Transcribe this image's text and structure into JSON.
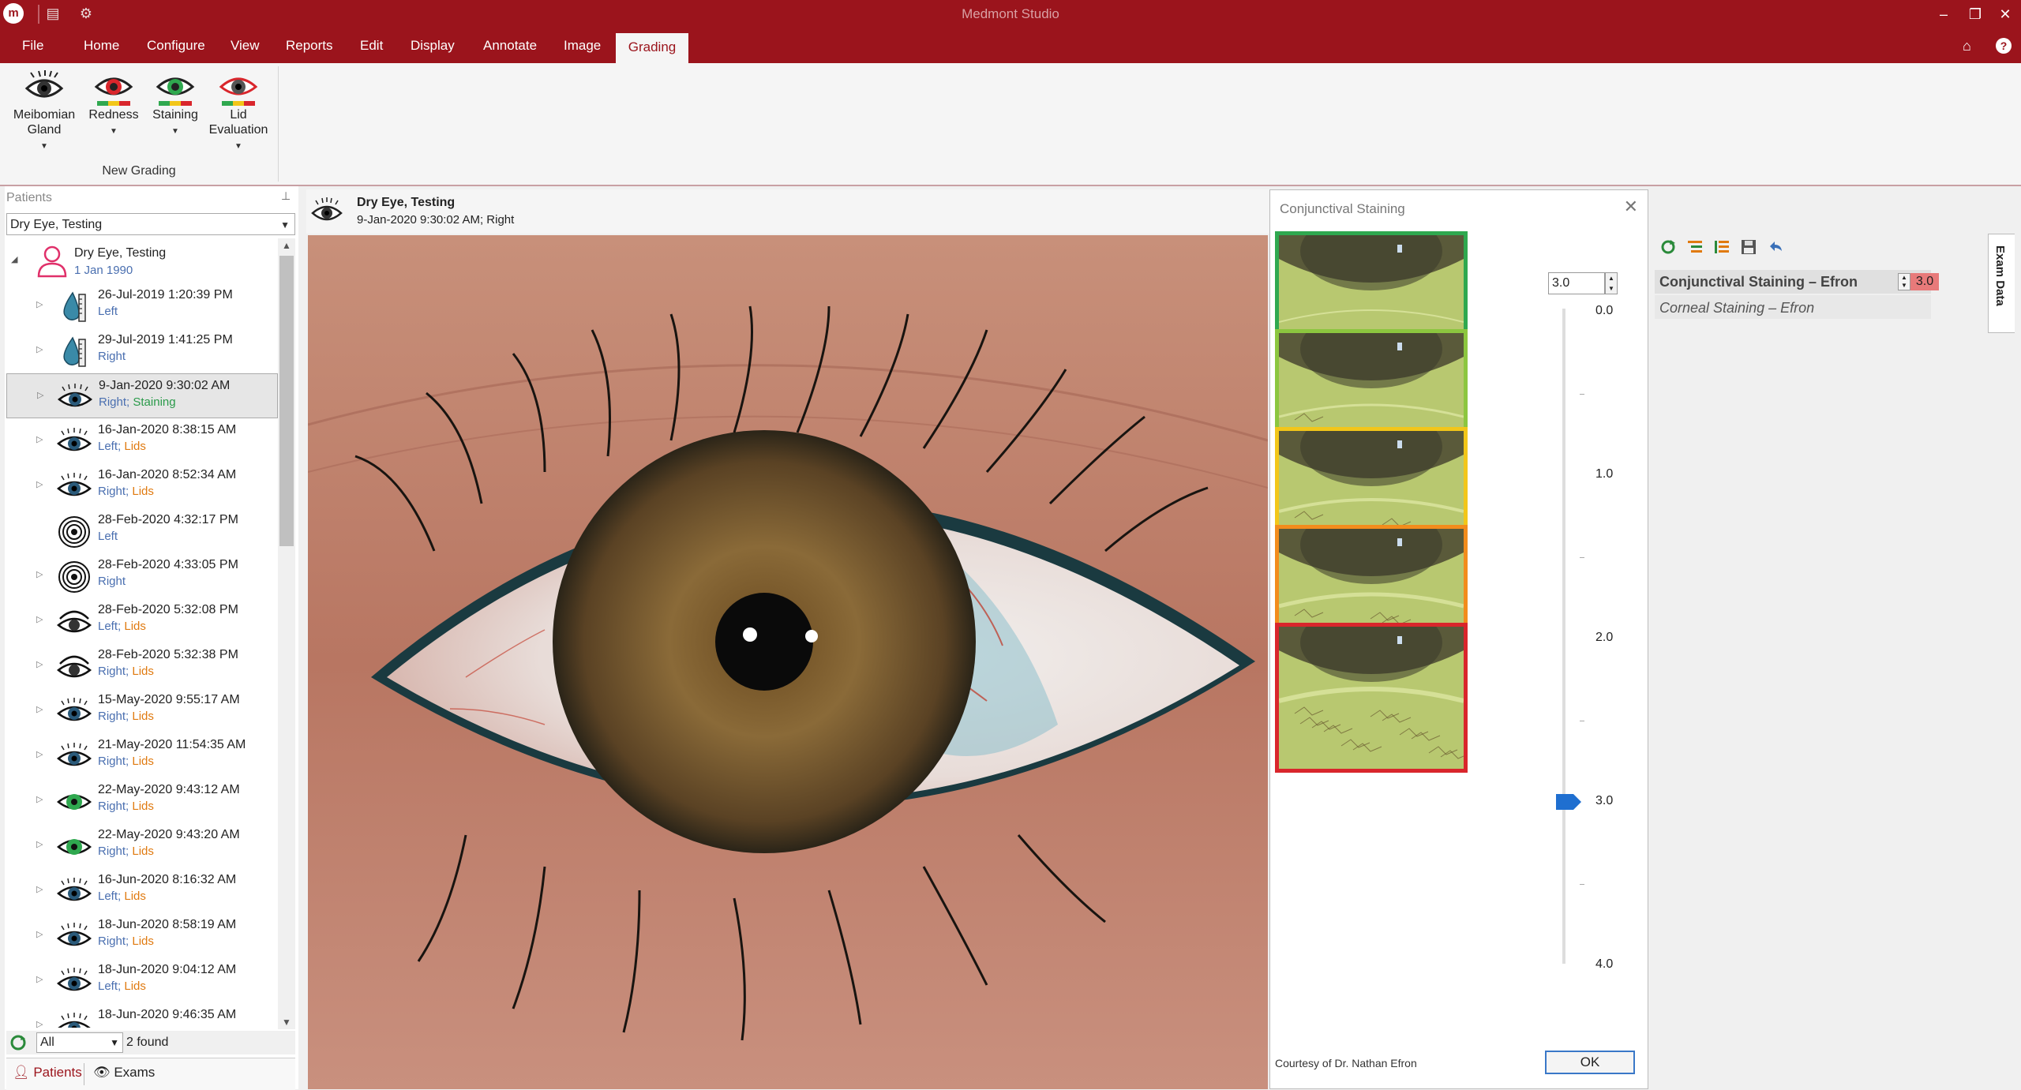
{
  "window": {
    "title": "Medmont Studio",
    "logo_text": "m"
  },
  "menu": {
    "items": [
      "File",
      "Home",
      "Configure",
      "View",
      "Reports",
      "Edit",
      "Display",
      "Annotate",
      "Image"
    ],
    "active_tab": "Grading"
  },
  "ribbon": {
    "buttons": [
      {
        "label": "Meibomian Gland",
        "icon": "eye-grading-icon"
      },
      {
        "label": "Redness",
        "icon": "eye-redness-icon"
      },
      {
        "label": "Staining",
        "icon": "eye-staining-icon"
      },
      {
        "label": "Lid Evaluation",
        "icon": "eye-lid-icon"
      }
    ],
    "group_label": "New Grading",
    "colors": {
      "red": "#d9262c",
      "green": "#2fa84f",
      "yellow": "#f2c619"
    }
  },
  "patients": {
    "header": "Patients",
    "selected_patient": "Dry Eye, Testing",
    "root": {
      "name": "Dry Eye, Testing",
      "dob": "1 Jan 1990"
    },
    "exams": [
      {
        "date": "26-Jul-2019 1:20:39 PM",
        "side": "Left",
        "type": "",
        "icon": "tear-drop-icon",
        "expander": true
      },
      {
        "date": "29-Jul-2019 1:41:25 PM",
        "side": "Right",
        "type": "",
        "icon": "tear-drop-icon",
        "expander": true
      },
      {
        "date": "9-Jan-2020 9:30:02 AM",
        "side": "Right",
        "type": "Staining",
        "icon": "eye-icon",
        "expander": true,
        "selected": true
      },
      {
        "date": "16-Jan-2020 8:38:15 AM",
        "side": "Left",
        "type": "Lids",
        "icon": "eye-icon",
        "expander": true
      },
      {
        "date": "16-Jan-2020 8:52:34 AM",
        "side": "Right",
        "type": "Lids",
        "icon": "eye-icon",
        "expander": true
      },
      {
        "date": "28-Feb-2020 4:32:17 PM",
        "side": "Left",
        "type": "",
        "icon": "placido-icon",
        "expander": false
      },
      {
        "date": "28-Feb-2020 4:33:05 PM",
        "side": "Right",
        "type": "",
        "icon": "placido-icon",
        "expander": true
      },
      {
        "date": "28-Feb-2020 5:32:08 PM",
        "side": "Left",
        "type": "Lids",
        "icon": "lid-eye-icon",
        "expander": true
      },
      {
        "date": "28-Feb-2020 5:32:38 PM",
        "side": "Right",
        "type": "Lids",
        "icon": "lid-eye-icon",
        "expander": true
      },
      {
        "date": "15-May-2020 9:55:17 AM",
        "side": "Right",
        "type": "Lids",
        "icon": "eye-icon",
        "expander": true
      },
      {
        "date": "21-May-2020 11:54:35 AM",
        "side": "Right",
        "type": "Lids",
        "icon": "eye-icon",
        "expander": true
      },
      {
        "date": "22-May-2020 9:43:12 AM",
        "side": "Right",
        "type": "Lids",
        "icon": "green-eye-icon",
        "expander": true
      },
      {
        "date": "22-May-2020 9:43:20 AM",
        "side": "Right",
        "type": "Lids",
        "icon": "green-eye-icon",
        "expander": true
      },
      {
        "date": "16-Jun-2020 8:16:32 AM",
        "side": "Left",
        "type": "Lids",
        "icon": "eye-icon",
        "expander": true
      },
      {
        "date": "18-Jun-2020 8:58:19 AM",
        "side": "Right",
        "type": "Lids",
        "icon": "eye-icon",
        "expander": true
      },
      {
        "date": "18-Jun-2020 9:04:12 AM",
        "side": "Left",
        "type": "Lids",
        "icon": "eye-icon",
        "expander": true
      },
      {
        "date": "18-Jun-2020 9:46:35 AM",
        "side": "",
        "type": "",
        "icon": "eye-icon",
        "expander": true
      }
    ],
    "filter": {
      "value": "All",
      "found": "2 found"
    },
    "tabs": [
      "Patients",
      "Exams"
    ]
  },
  "image_header": {
    "name": "Dry Eye, Testing",
    "info": "9-Jan-2020 9:30:02 AM; Right"
  },
  "dialog": {
    "title": "Conjunctival Staining",
    "value": "3.0",
    "grade_border_colors": [
      "#2fa84f",
      "#8cc63f",
      "#f2c619",
      "#f28c1c",
      "#d9262c"
    ],
    "scale_labels": [
      "0.0",
      "1.0",
      "2.0",
      "3.0",
      "4.0"
    ],
    "scale_max": 4.0,
    "courtesy": "Courtesy of Dr. Nathan Efron",
    "ok_label": "OK"
  },
  "exam_data": {
    "rows": [
      {
        "label": "Conjunctival Staining – Efron",
        "value": "3.0"
      },
      {
        "label": "Corneal Staining – Efron"
      }
    ],
    "tab_label": "Exam Data",
    "value_color": "#e87a7a"
  }
}
